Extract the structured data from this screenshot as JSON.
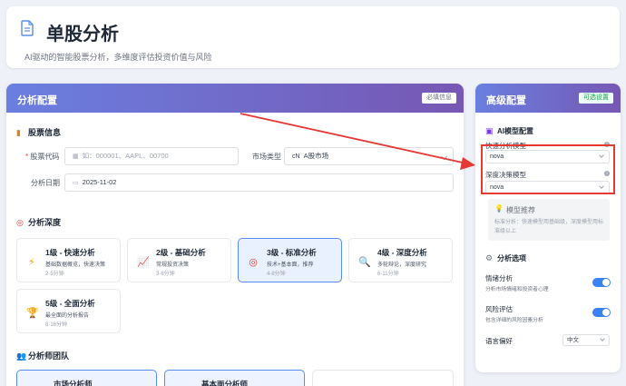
{
  "header": {
    "title": "单股分析",
    "subtitle": "AI驱动的智能股票分析，多维度评估投资价值与风险"
  },
  "config": {
    "title": "分析配置",
    "badge": "必填信息",
    "stock_section": "股票信息",
    "code_label": "股票代码",
    "code_placeholder": "如：000001、AAPL、00700",
    "market_label": "市场类型",
    "market_prefix": "cN",
    "market_value": "A股市场",
    "date_label": "分析日期",
    "date_value": "2025-11-02",
    "depth_section": "分析深度",
    "depth_levels": [
      {
        "title": "1级 - 快速分析",
        "desc": "基础数据概览，快速决策",
        "time": "2-5分钟",
        "icon": "lightning-icon"
      },
      {
        "title": "2级 - 基础分析",
        "desc": "常规投资决策",
        "time": "3-6分钟",
        "icon": "chart-icon"
      },
      {
        "title": "3级 - 标准分析",
        "desc": "技术+基本面，推荐",
        "time": "4-8分钟",
        "icon": "target-icon"
      },
      {
        "title": "4级 - 深度分析",
        "desc": "多轮辩论，深度研究",
        "time": "6-11分钟",
        "icon": "magnifier-icon"
      },
      {
        "title": "5级 - 全面分析",
        "desc": "最全面的分析报告",
        "time": "8-16分钟",
        "icon": "trophy-icon"
      }
    ],
    "team_section": "分析师团队",
    "team_cards": [
      {
        "title": "市场分析师"
      },
      {
        "title": "基本面分析师"
      },
      {
        "title": ""
      }
    ]
  },
  "advanced": {
    "title": "高级配置",
    "badge": "可选设置",
    "model_section": "AI模型配置",
    "quick_label": "快速分析模型",
    "quick_value": "nova",
    "deep_label": "深度决策模型",
    "deep_value": "nova",
    "reco_title": "模型推荐",
    "reco_text": "标准分析：快速模型用基础级，深度模型用标准级以上",
    "options_section": "分析选项",
    "sentiment_title": "情绪分析",
    "sentiment_desc": "分析市场情绪和投资者心理",
    "sentiment_on": true,
    "risk_title": "风险评估",
    "risk_desc": "包含详细的风险因素分析",
    "risk_on": true,
    "lang_label": "语言偏好",
    "lang_value": "中文"
  },
  "colors": {
    "accent": "#5b8def",
    "header_gradient_start": "#6a7fe0",
    "header_gradient_end": "#7757b3",
    "annotation": "#e53935",
    "toggle_on": "#3b82f6"
  }
}
